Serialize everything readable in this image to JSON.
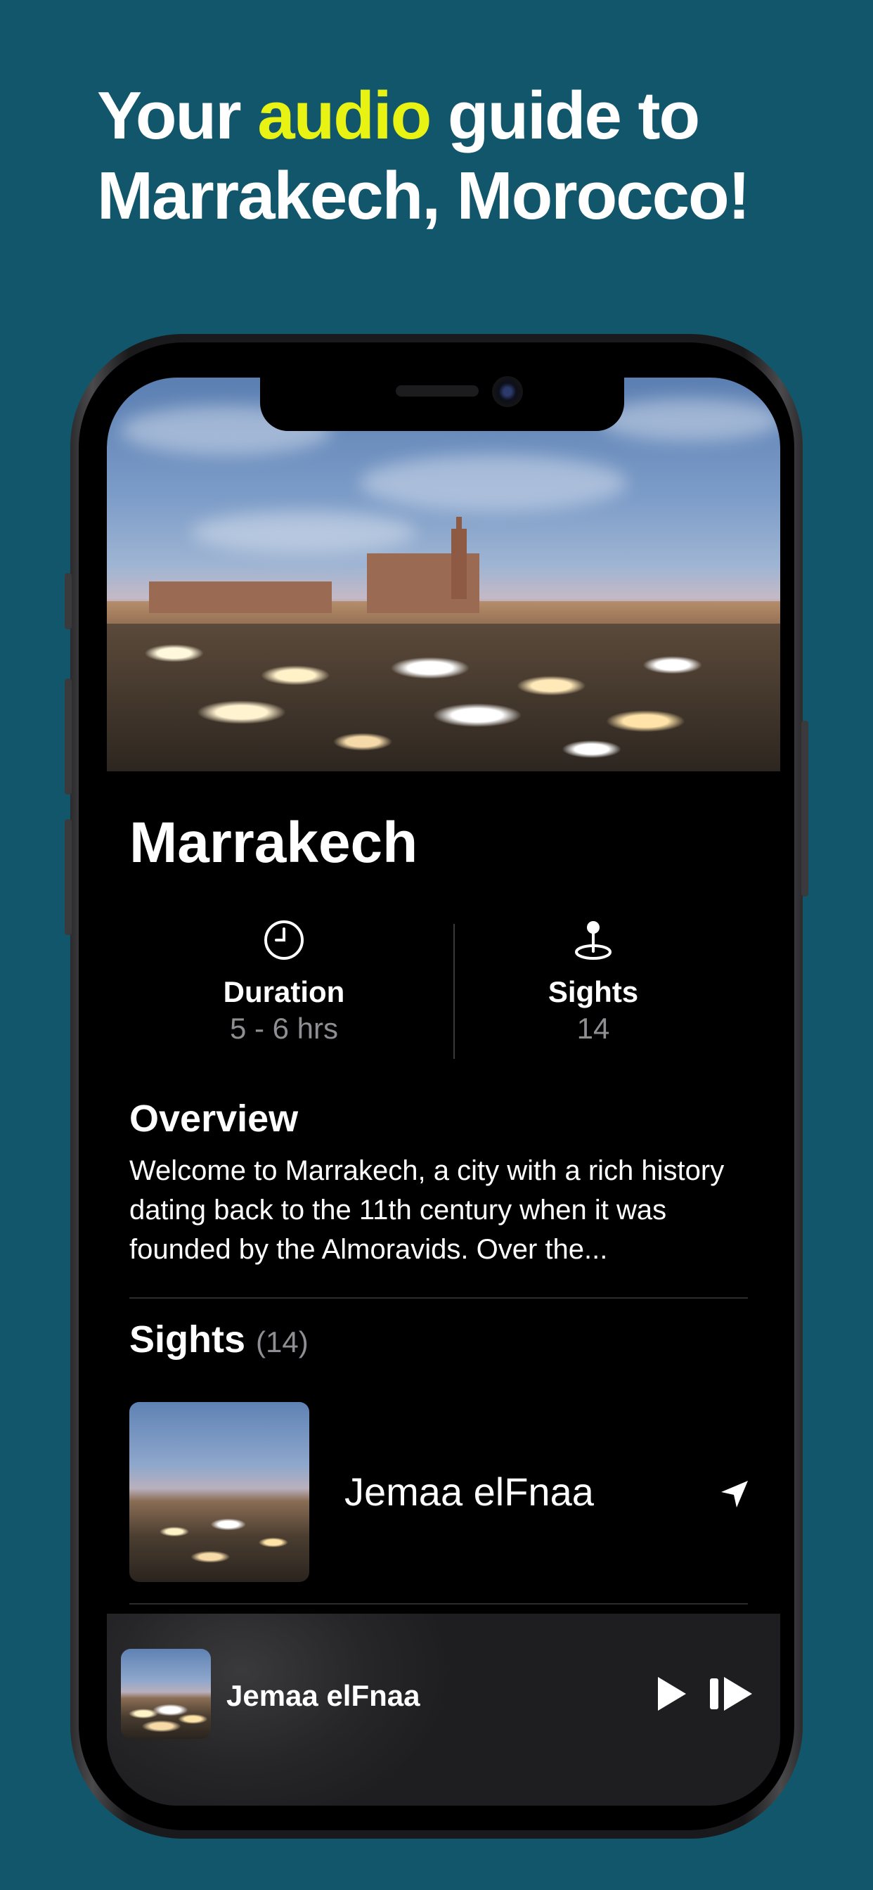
{
  "headline": {
    "prefix": "Your ",
    "highlight": "audio",
    "suffix": " guide to",
    "line2": "Marrakech, Morocco!"
  },
  "colors": {
    "background": "#11566a",
    "highlight": "#e8f213",
    "screen": "#000000",
    "secondary_text": "#8e8e93"
  },
  "tour": {
    "title": "Marrakech",
    "hero_image_icon": "market-square-photo",
    "stats": [
      {
        "icon": "clock-icon",
        "label": "Duration",
        "value": "5 - 6 hrs"
      },
      {
        "icon": "map-pin-icon",
        "label": "Sights",
        "value": "14"
      }
    ]
  },
  "overview": {
    "heading": "Overview",
    "text": "Welcome to Marrakech, a city with a rich history dating back to the 11th century when it was founded by the Almoravids. Over the..."
  },
  "sights": {
    "heading": "Sights",
    "count": "(14)",
    "items": [
      {
        "name": "Jemaa elFnaa",
        "action_icon": "location-arrow-icon"
      }
    ]
  },
  "player": {
    "title": "Jemaa elFnaa",
    "play_icon": "play-icon",
    "next_icon": "skip-forward-icon"
  }
}
